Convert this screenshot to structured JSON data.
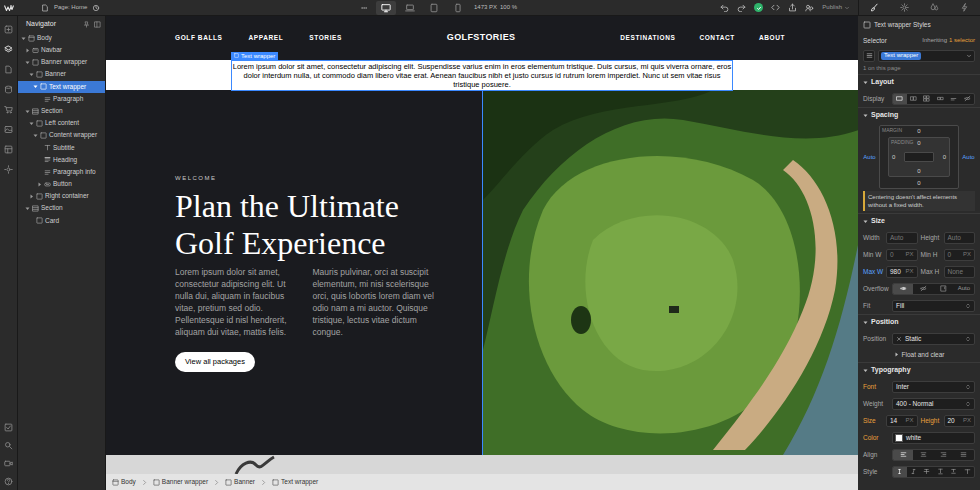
{
  "topbar": {
    "page": "Page: Home",
    "canvas_width": "1473 PX",
    "zoom": "100 %",
    "publish": "Publish",
    "saved": true,
    "breakpoints": [
      {
        "selected": true
      },
      {
        "selected": false
      },
      {
        "selected": false
      },
      {
        "selected": false
      }
    ],
    "panel_tabs": [
      {
        "selected": true
      },
      {
        "selected": false
      },
      {
        "selected": false
      },
      {
        "selected": false
      }
    ]
  },
  "tools": [
    {
      "selected": false
    },
    {
      "selected": true
    },
    {
      "selected": false
    },
    {
      "selected": false
    },
    {
      "selected": false
    },
    {
      "selected": false
    },
    {
      "selected": false
    },
    {
      "selected": false
    }
  ],
  "bottom_tools": [
    {
      "selected": false
    },
    {
      "selected": false
    },
    {
      "selected": false
    },
    {
      "selected": false
    }
  ],
  "navigator": {
    "title": "Navigator",
    "items": [
      {
        "label": "Body",
        "kind": "body",
        "selected": false,
        "expanded": true,
        "children": [
          {
            "label": "Navbar",
            "kind": "navbar",
            "selected": false,
            "expanded": false
          },
          {
            "label": "Banner wrapper",
            "kind": "box",
            "selected": false,
            "expanded": true,
            "children": [
              {
                "label": "Banner",
                "kind": "box",
                "selected": false,
                "expanded": true,
                "children": [
                  {
                    "label": "Text wrapper",
                    "kind": "box",
                    "selected": true,
                    "expanded": true,
                    "children": [
                      {
                        "label": "Paragraph",
                        "kind": "paragraph",
                        "selected": false
                      }
                    ]
                  }
                ]
              }
            ]
          },
          {
            "label": "Section",
            "kind": "section",
            "selected": false,
            "expanded": true,
            "children": [
              {
                "label": "Left content",
                "kind": "box",
                "selected": false,
                "expanded": true,
                "children": [
                  {
                    "label": "Content wrapper",
                    "kind": "box",
                    "selected": false,
                    "expanded": true,
                    "children": [
                      {
                        "label": "Subtitle",
                        "kind": "text",
                        "selected": false
                      },
                      {
                        "label": "Heading",
                        "kind": "heading",
                        "selected": false
                      },
                      {
                        "label": "Paragraph info",
                        "kind": "paragraph",
                        "selected": false
                      },
                      {
                        "label": "Button",
                        "kind": "link",
                        "selected": false,
                        "expanded": false
                      }
                    ]
                  }
                ]
              },
              {
                "label": "Right container",
                "kind": "box",
                "selected": false,
                "expanded": false
              }
            ]
          },
          {
            "label": "Section",
            "kind": "section",
            "selected": false,
            "expanded": true,
            "children": [
              {
                "label": "Card",
                "kind": "box",
                "selected": false
              }
            ]
          }
        ]
      }
    ]
  },
  "canvas": {
    "nav": {
      "left": [
        "GOLF BALLS",
        "APPAREL",
        "STORIES"
      ],
      "logo": "GOLFSTORIES",
      "right": [
        "DESTINATIONS",
        "CONTACT",
        "ABOUT"
      ]
    },
    "banner": {
      "selection_label": "Text wrapper",
      "text": "Lorem ipsum dolor sit amet, consectetur adipiscing elit. Suspendisse varius enim in eros elementum tristique. Duis cursus, mi quis viverra ornare, eros dolor interdum nulla, ut commodo diam libero vitae erat. Aenean faucibus nibh et justo cursus id rutrum lorem imperdiet. Nunc ut sem vitae risus tristique posuere."
    },
    "hero": {
      "subtitle": "WELCOME",
      "heading": "Plan the Ultimate Golf Experience",
      "paragraph": "Lorem ipsum dolor sit amet, consectetur adipiscing elit. Ut nulla dui, aliquam in faucibus vitae, pretium sed odio. Pellentesque id nisl hendrerit, aliquam dui vitae, mattis felis. Mauris pulvinar, orci at suscipit elementum, mi nisi scelerisque orci, quis lobortis lorem diam vel odio nam a mi auctor. Quisque tristique, lectus vitae dictum congue.",
      "button": "View all packages"
    }
  },
  "breadcrumb": [
    {
      "label": "Body",
      "kind": "body"
    },
    {
      "label": "Banner wrapper",
      "kind": "box"
    },
    {
      "label": "Banner",
      "kind": "box"
    },
    {
      "label": "Text wrapper",
      "kind": "box"
    }
  ],
  "styles": {
    "title": "Text wrapper Styles",
    "selector": {
      "label": "Selector",
      "inheriting": "Inheriting",
      "inherit_count": "1 selector",
      "chip": "Text wrapper",
      "count": "1 on this page"
    },
    "layout": {
      "title": "Layout",
      "display": {
        "label": "Display",
        "options": [
          {
            "selected": true
          },
          {
            "selected": false
          },
          {
            "selected": false
          },
          {
            "selected": false
          },
          {
            "selected": false
          },
          {
            "selected": false
          }
        ]
      }
    },
    "spacing": {
      "title": "Spacing",
      "margin_label": "MARGIN",
      "padding_label": "PADDING",
      "margin": {
        "top": {
          "value": "0",
          "source": "none"
        },
        "right": {
          "value": "Auto",
          "source": "local"
        },
        "bottom": {
          "value": "0",
          "source": "none"
        },
        "left": {
          "value": "Auto",
          "source": "local"
        }
      },
      "padding": {
        "top": {
          "value": "0",
          "source": "none"
        },
        "right": {
          "value": "0",
          "source": "none"
        },
        "bottom": {
          "value": "0",
          "source": "none"
        },
        "left": {
          "value": "0",
          "source": "none"
        }
      },
      "note": "Centering doesn't affect elements without a fixed width."
    },
    "size": {
      "title": "Size",
      "fields": [
        {
          "label": "Width",
          "value": "Auto",
          "source": "none"
        },
        {
          "label": "Height",
          "value": "Auto",
          "source": "none"
        },
        {
          "label": "Min W",
          "value": "0",
          "unit": "PX",
          "source": "none"
        },
        {
          "label": "Min H",
          "value": "0",
          "unit": "PX",
          "source": "none"
        },
        {
          "label": "Max W",
          "value": "980",
          "unit": "PX",
          "source": "local"
        },
        {
          "label": "Max H",
          "value": "None",
          "source": "none"
        }
      ],
      "overflow": {
        "label": "Overflow",
        "options": [
          {
            "selected": true
          },
          {
            "selected": false
          },
          {
            "selected": false
          }
        ],
        "auto": {
          "label": "Auto",
          "selected": false
        }
      },
      "fit": {
        "label": "Fit",
        "value": "Fill"
      }
    },
    "position": {
      "title": "Position",
      "label": "Position",
      "value": "Static",
      "float": "Float and clear"
    },
    "typography": {
      "title": "Typography",
      "font": {
        "label": "Font",
        "value": "Inter",
        "source": "inherited"
      },
      "weight": {
        "label": "Weight",
        "value": "400 - Normal",
        "source": "none"
      },
      "size": {
        "label": "Size",
        "value": "14",
        "unit": "PX",
        "source": "inherited"
      },
      "height": {
        "label": "Height",
        "value": "20",
        "unit": "PX",
        "source": "inherited"
      },
      "color": {
        "label": "Color",
        "value": "white",
        "swatch": "#ffffff",
        "source": "inherited"
      },
      "align": {
        "label": "Align",
        "options": [
          {
            "selected": true
          },
          {
            "selected": false
          },
          {
            "selected": false
          },
          {
            "selected": false
          }
        ]
      },
      "style": {
        "label": "Style",
        "options": [
          {
            "selected": true
          },
          {
            "selected": false
          },
          {
            "selected": false
          },
          {
            "selected": false
          },
          {
            "selected": false
          },
          {
            "selected": false
          }
        ]
      }
    }
  }
}
